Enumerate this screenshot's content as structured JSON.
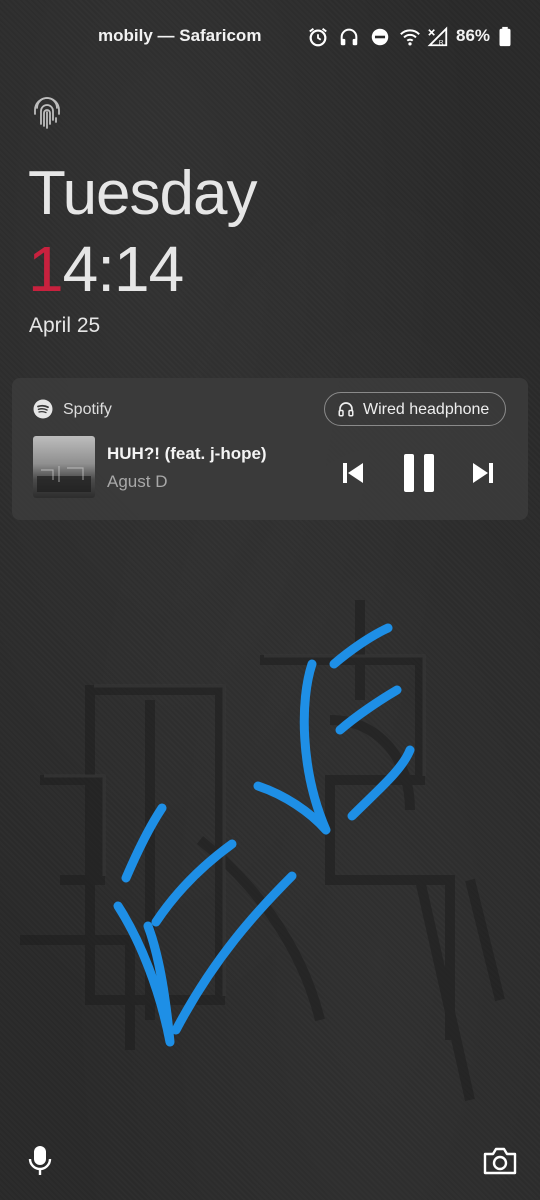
{
  "status_bar": {
    "carrier": "mobily — Safaricom",
    "battery": "86%",
    "icons": [
      "alarm-icon",
      "headphones-icon",
      "do-not-disturb-icon",
      "wifi-icon",
      "signal-icon",
      "battery-icon"
    ]
  },
  "lockscreen": {
    "day": "Tuesday",
    "time_first": "1",
    "time_rest": "4:14",
    "date": "April 25",
    "accent_color": "#c8213e"
  },
  "media": {
    "app": "Spotify",
    "output": "Wired headphone",
    "title": "HUH?! (feat. j-hope)",
    "artist": "Agust D",
    "controls": [
      "previous-icon",
      "pause-icon",
      "next-icon"
    ]
  },
  "bottom": {
    "left_icon": "microphone-icon",
    "right_icon": "camera-icon"
  },
  "annotation_color": "#1e8fe6"
}
